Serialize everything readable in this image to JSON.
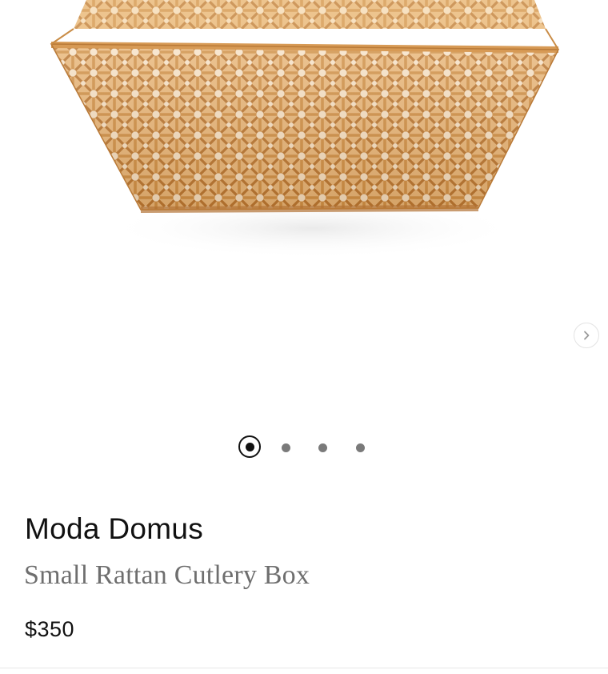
{
  "product": {
    "brand": "Moda Domus",
    "name": "Small Rattan Cutlery Box",
    "price": "$350"
  },
  "gallery": {
    "image_subject": "rattan cutlery box",
    "next_icon": "chevron-right-icon",
    "dot_count": 4,
    "active_dot": 0
  },
  "colors": {
    "text_primary": "#111111",
    "text_secondary": "#6e6e6e",
    "dot_inactive": "#7a7a7a",
    "rattan": "#c88a3e"
  }
}
